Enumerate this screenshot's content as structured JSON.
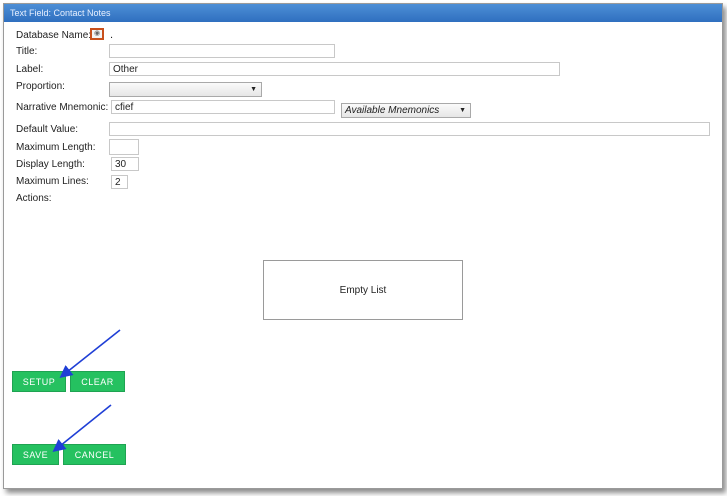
{
  "window": {
    "title": "Text Field: Contact Notes"
  },
  "fields": {
    "database_name": {
      "label": "Database Name:",
      "value": "."
    },
    "title": {
      "label": "Title:",
      "value": ""
    },
    "label": {
      "label": "Label:",
      "value": "Other"
    },
    "proportion": {
      "label": "Proportion:",
      "value": ""
    },
    "narrative_mnemonic": {
      "label": "Narrative Mnemonic:",
      "value": "cfief"
    },
    "available_mnemonics": {
      "value": "Available Mnemonics"
    },
    "default_value": {
      "label": "Default Value:",
      "value": ""
    },
    "maximum_length": {
      "label": "Maximum Length:",
      "value": ""
    },
    "display_length": {
      "label": "Display Length:",
      "value": "30"
    },
    "maximum_lines": {
      "label": "Maximum Lines:",
      "value": "2"
    },
    "actions": {
      "label": "Actions:"
    }
  },
  "actions_list": {
    "empty_text": "Empty List"
  },
  "buttons": {
    "setup": "SETUP",
    "clear": "CLEAR",
    "save": "SAVE",
    "cancel": "CANCEL"
  },
  "colors": {
    "button_green": "#25c160",
    "titlebar_blue": "#2f6fbf",
    "annotation_arrow": "#1f3fd6",
    "icon_highlight": "#c8501c"
  },
  "icons": {
    "database_name_icon": "eye-icon"
  }
}
